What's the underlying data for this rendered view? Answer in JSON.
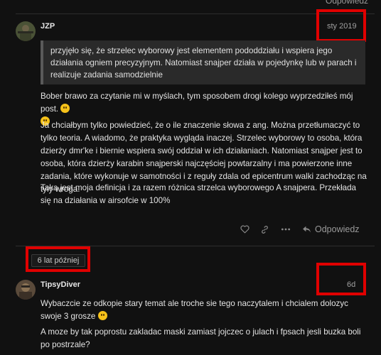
{
  "posts": [
    {
      "username": "JZP",
      "date": "sty 2019",
      "quote": "przyjęło się, że strzelec wyborowy jest elementem pododdziału i wspiera jego działania ogniem precyzyjnym. Natomiast snajper działa w pojedynkę lub w parach i realizuje zadania samodzielnie",
      "paragraphs": [
        "Bober brawo za czytanie mi w myślach, tym sposobem drogi kolego wyprzedziłeś mój post.",
        "Ja chciałbym tylko powiedzieć, że o ile znaczenie słowa z ang. Można przetłumaczyć to tylko teoria. A wiadomo, że praktyka wygląda inaczej. Strzelec wyborowy to osoba, która dzierży dmr'ke i biernie wspiera swój oddział w ich działaniach. Natomiast snajper jest to osoba, która dzierży karabin snajperski najczęściej powtarzalny i ma powierzone inne zadania, które wykonuje w samotności i z reguły zdala od epicentrum walki zachodząc na tyły wroga.",
        "Taka jest moja definicja i za razem różnica strzelca wyborowego A snajpera. Przekłada się na działania w airsofcie w 100%"
      ],
      "reply_label": "Odpowiedz"
    },
    {
      "username": "TipsyDiver",
      "date": "6d",
      "paragraphs": [
        "Wybaczcie ze odkopie stary temat ale troche sie tego naczytalem i chcialem dolozyc swoje 3 grosze",
        "A moze by tak poprostu zakladac maski zamiast jojczec o julach i fpsach jesli buzka boli po postrzale?"
      ]
    }
  ],
  "time_gap": "6 lat później",
  "top_stub": "Odpowiedz",
  "icons": [
    "heart-icon",
    "link-icon",
    "more-icon",
    "reply-icon",
    "emoji-slight-smile",
    "emoji-smiley"
  ],
  "colors": {
    "background": "#111111",
    "highlight": "#e00000",
    "text": "#dddddd",
    "muted": "#9a9a9a"
  }
}
